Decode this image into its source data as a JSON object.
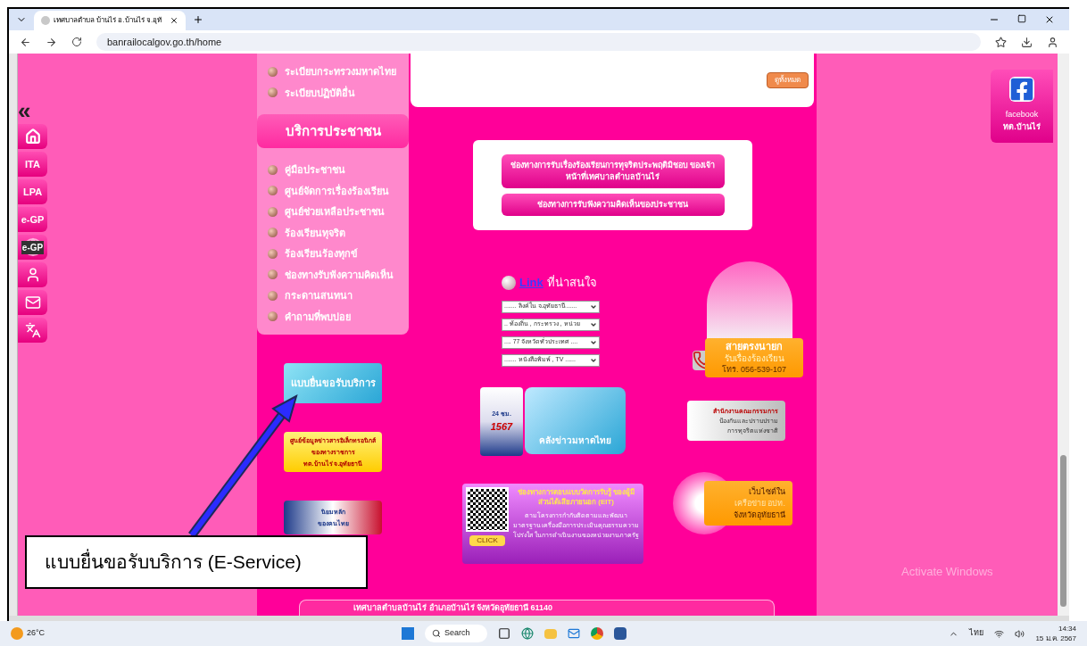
{
  "browser": {
    "tab_title": "เทศบาลตำบล บ้านไร่ อ.บ้านไร่ จ.อุทั",
    "url": "banrailocalgov.go.th/home"
  },
  "left_bar": {
    "collapse": "«",
    "items": [
      {
        "kind": "home"
      },
      {
        "kind": "text",
        "label": "ITA"
      },
      {
        "kind": "text",
        "label": "LPA"
      },
      {
        "kind": "text",
        "label": "e-GP"
      },
      {
        "kind": "globe",
        "label": "e-GP"
      },
      {
        "kind": "person"
      },
      {
        "kind": "mail"
      },
      {
        "kind": "translate"
      }
    ]
  },
  "menu_top": [
    "ระเบียบกระทรวงมหาดไทย",
    "ระเบียบปฏิบัติอื่น"
  ],
  "service_menu": {
    "title": "บริการประชาชน",
    "items": [
      "คู่มือประชาชน",
      "ศูนย์จัดการเรื่องร้องเรียน",
      "ศูนย์ช่วยเหลือประชาชน",
      "ร้องเรียนทุจริต",
      "ร้องเรียนร้องทุกข์",
      "ช่องทางรับฟังความคิดเห็น",
      "กระดานสนทนา",
      "คำถามที่พบบ่อย"
    ]
  },
  "left_banners": [
    {
      "kind": "eservice",
      "lines": [
        "แบบยื่นขอรับบริการ"
      ]
    },
    {
      "kind": "info",
      "lines": [
        "ศูนย์ข้อมูลข่าวสารอิเล็กทรอนิกส์",
        "ของทางราชการ",
        "ทต.บ้านไร่ จ.อุทัยธานี"
      ]
    },
    {
      "kind": "values",
      "lines": [
        "นิยมหลัก",
        "ของคนไทย"
      ]
    }
  ],
  "news_more_button": "ดูทั้งหมด",
  "complaint_buttons": [
    "ช่องทางการรับเรื่องร้องเรียนการทุจริตประพฤติมิชอบ ของเจ้าหน้าที่เทศบาลตำบลบ้านไร่",
    "ช่องทางการรับฟังความคิดเห็นของประชาชน"
  ],
  "links": {
    "link_word": "Link",
    "caption": "ที่น่าสนใจ",
    "selects": [
      "....... ลิงค์ใน จ.อุทัยธานี......",
      ".. ท้องถิ่น , กระทรวง , หน่วย",
      ".... 77 จังหวัดทั่วประเทศ ....",
      "....... หนังสือพิมพ์ , TV ......"
    ]
  },
  "mayor_hotline": {
    "title": "สายตรงนายก",
    "subtitle": "รับเรื่องร้องเรียน",
    "phone": "โทร. 056-539-107"
  },
  "banner_1567": [
    "24 ชม.",
    "1567"
  ],
  "banner_news": "คลังข่าวมหาดไทย",
  "banner_nacc": [
    "สำนักงานคณะกรรมการ",
    "ป้องกันและปราบปราม",
    "การทุจริตแห่งชาติ"
  ],
  "banner_eit": {
    "title": "ช่องทางการตอบแบบวัดการรับรู้ ของผู้มีส่วนได้เสียภายนอก (EIT)",
    "body": "ตามโครงการกำกับติดตามและพัฒนามาตรฐาน เครื่องมือการประเมินคุณธรรมความโปร่งใส ในการดำเนินงานของหน่วยงานภาครัฐ",
    "button": "CLICK"
  },
  "banner_network": [
    "เว็บไซต์ใน",
    "เครือข่าย อปท.",
    "จังหวัดอุทัยธานี"
  ],
  "facebook": [
    "facebook",
    "ทต.บ้านไร่"
  ],
  "footer": "เทศบาลตำบลบ้านไร่ อำเภอบ้านไร่ จังหวัดอุทัยธานี 61140",
  "watermark_os": "Activate Windows",
  "annotation": "แบบยื่นขอรับบริการ (E-Service)",
  "taskbar": {
    "weather": "26°C",
    "search": "Search",
    "language": "ไทย",
    "time": "14:34",
    "date": "15 ม.ค. 2567"
  }
}
